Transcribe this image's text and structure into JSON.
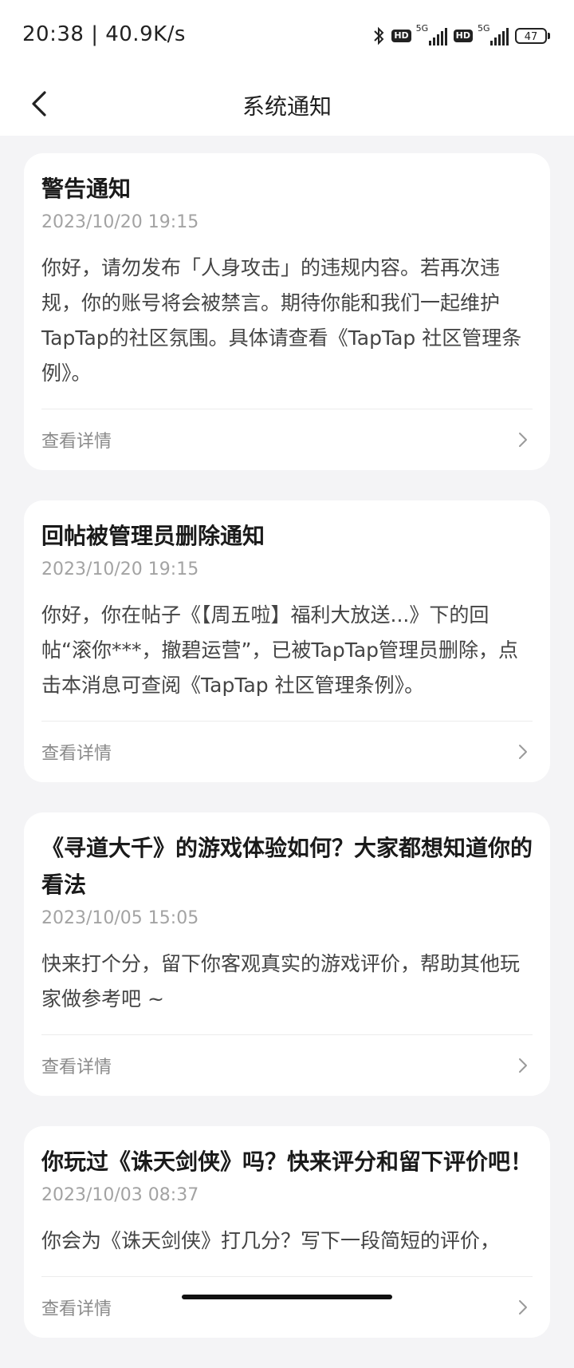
{
  "status_bar": {
    "time_speed": "20:38 | 40.9K/s",
    "hd_label": "HD",
    "network_label": "5G",
    "battery": "47"
  },
  "header": {
    "title": "系统通知"
  },
  "notifications": [
    {
      "title": "警告通知",
      "date": "2023/10/20 19:15",
      "body": "你好，请勿发布「人身攻击」的违规内容。若再次违规，你的账号将会被禁言。期待你能和我们一起维护TapTap的社区氛围。具体请查看《TapTap 社区管理条例》。",
      "detail_label": "查看详情"
    },
    {
      "title": "回帖被管理员删除通知",
      "date": "2023/10/20 19:15",
      "body": "你好，你在帖子《【周五啦】福利大放送...》下的回帖“滚你***，撤碧运营”，已被TapTap管理员删除，点击本消息可查阅《TapTap 社区管理条例》。",
      "detail_label": "查看详情"
    },
    {
      "title": "《寻道大千》的游戏体验如何？大家都想知道你的看法",
      "date": "2023/10/05 15:05",
      "body": "快来打个分，留下你客观真实的游戏评价，帮助其他玩家做参考吧 ~",
      "detail_label": "查看详情"
    },
    {
      "title": "你玩过《诛天剑侠》吗？快来评分和留下评价吧！",
      "date": "2023/10/03 08:37",
      "body": "你会为《诛天剑侠》打几分？写下一段简短的评价，",
      "detail_label": "查看详情"
    }
  ]
}
